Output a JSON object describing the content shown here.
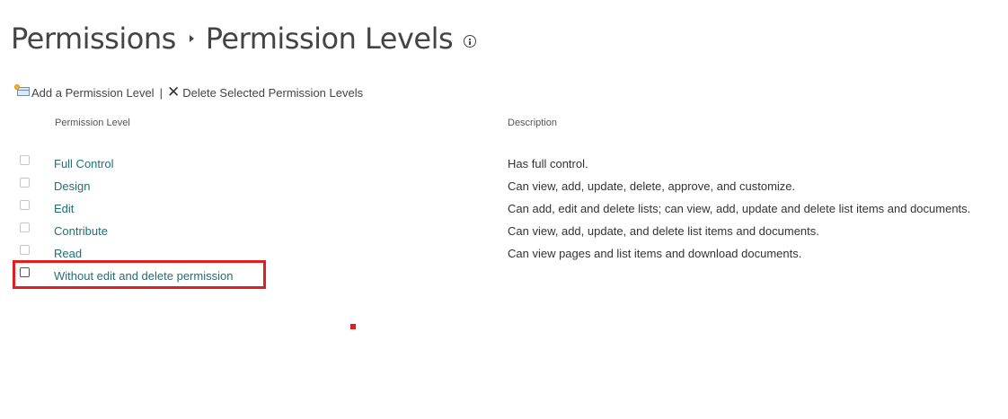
{
  "breadcrumb": {
    "parent": "Permissions",
    "current": "Permission Levels"
  },
  "icons": {
    "breadcrumb_separator": "triangle-right-icon",
    "info": "info-circle-icon",
    "add": "add-permission-level-icon",
    "delete": "x-icon"
  },
  "toolbar": {
    "add_label": "Add a Permission Level",
    "separator": "|",
    "delete_label": "Delete Selected Permission Levels"
  },
  "table": {
    "columns": {
      "level": "Permission Level",
      "description": "Description"
    },
    "rows": [
      {
        "name": "Full Control",
        "description": "Has full control.",
        "checked": false
      },
      {
        "name": "Design",
        "description": "Can view, add, update, delete, approve, and customize.",
        "checked": false
      },
      {
        "name": "Edit",
        "description": "Can add, edit and delete lists; can view, add, update and delete list items and documents.",
        "checked": false
      },
      {
        "name": "Contribute",
        "description": "Can view, add, update, and delete list items and documents.",
        "checked": false
      },
      {
        "name": "Read",
        "description": "Can view pages and list items and download documents.",
        "checked": false
      },
      {
        "name": "Without edit and delete permission",
        "description": "",
        "checked": false
      }
    ]
  },
  "colors": {
    "link": "#1f6f7a",
    "annotation": "#e02020",
    "text": "#333333"
  }
}
